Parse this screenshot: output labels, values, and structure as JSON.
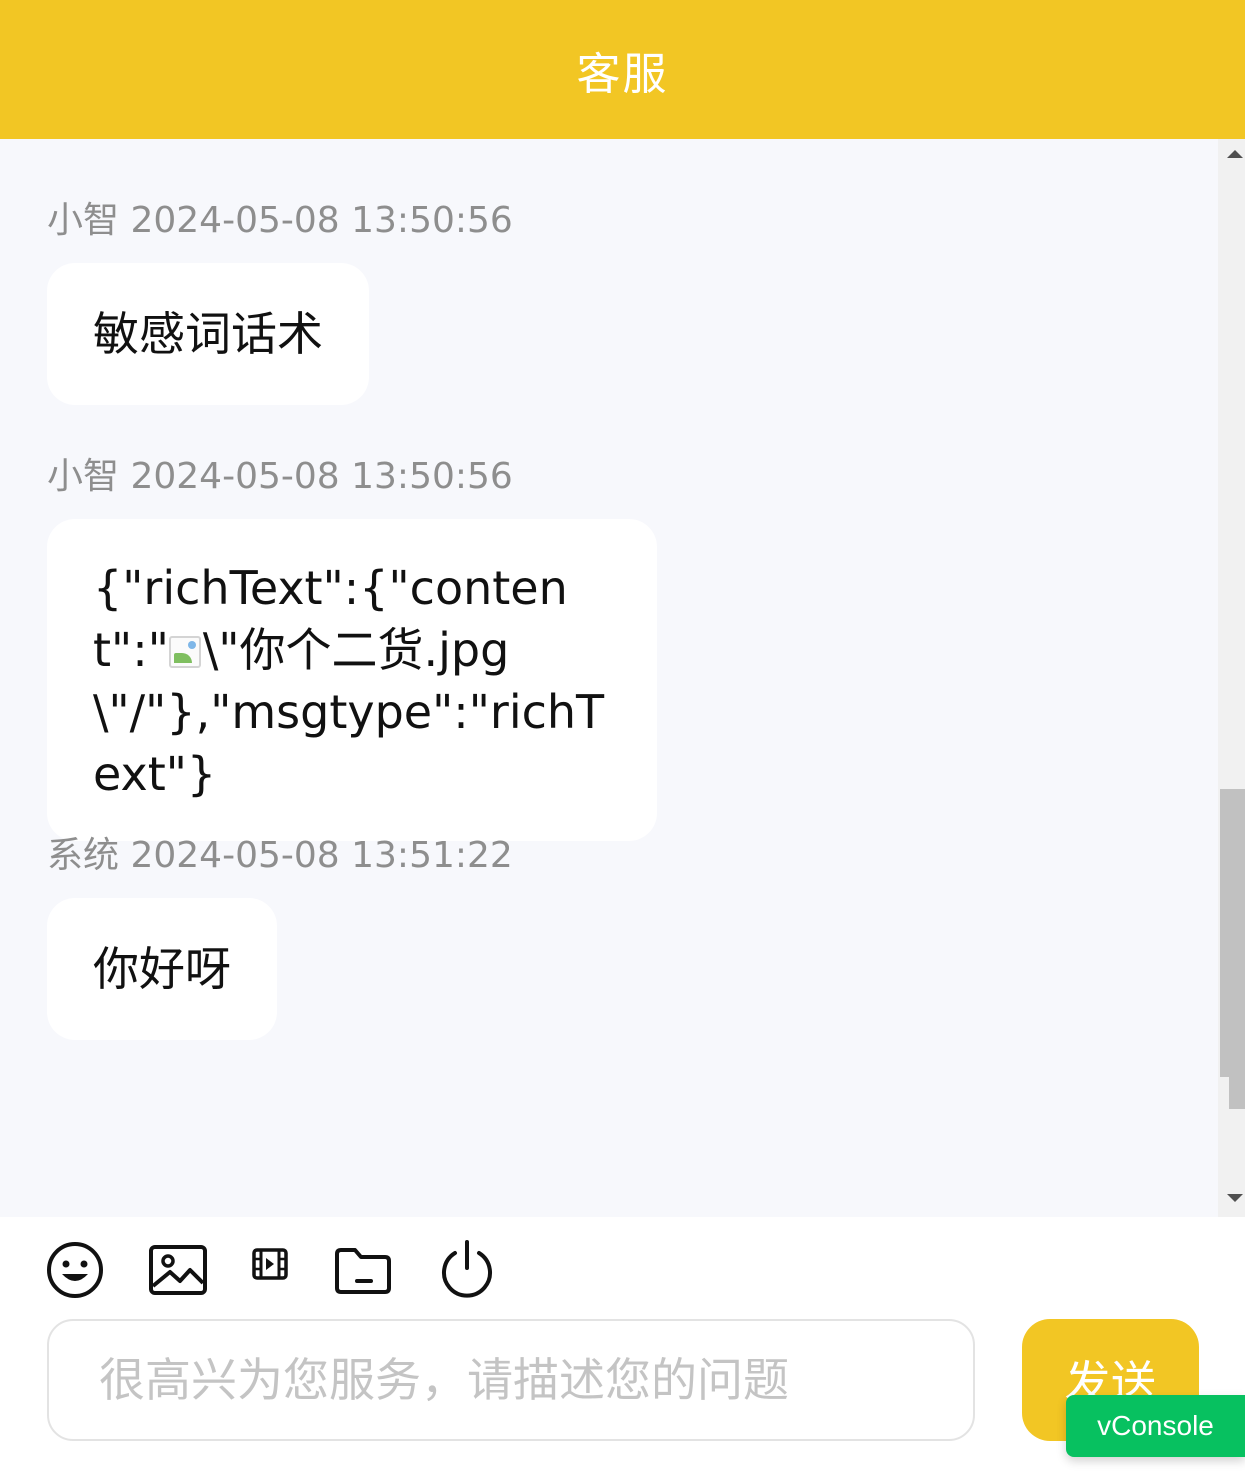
{
  "header": {
    "title": "客服"
  },
  "messages": [
    {
      "sender": "小智",
      "time": "2024-05-08 13:50:56",
      "text": "敏感词话术"
    },
    {
      "sender": "小智",
      "time": "2024-05-08 13:50:56",
      "text_before": "{\"richText\":{\"content\":\"",
      "text_after": "\\\"你个二货.jpg\\\"/\"},\"msgtype\":\"richText\"}"
    },
    {
      "sender": "系统",
      "time": "2024-05-08 13:51:22",
      "text": "你好呀"
    }
  ],
  "toolbar": {
    "icons": [
      "emoji-icon",
      "image-icon",
      "video-icon",
      "folder-icon",
      "power-icon"
    ]
  },
  "input": {
    "placeholder": "很高兴为您服务，请描述您的问题",
    "value": ""
  },
  "send_label": "发送",
  "vconsole_label": "vConsole",
  "colors": {
    "accent": "#f2c624",
    "vconsole": "#07c160",
    "chat_bg": "#f7f8fc"
  }
}
